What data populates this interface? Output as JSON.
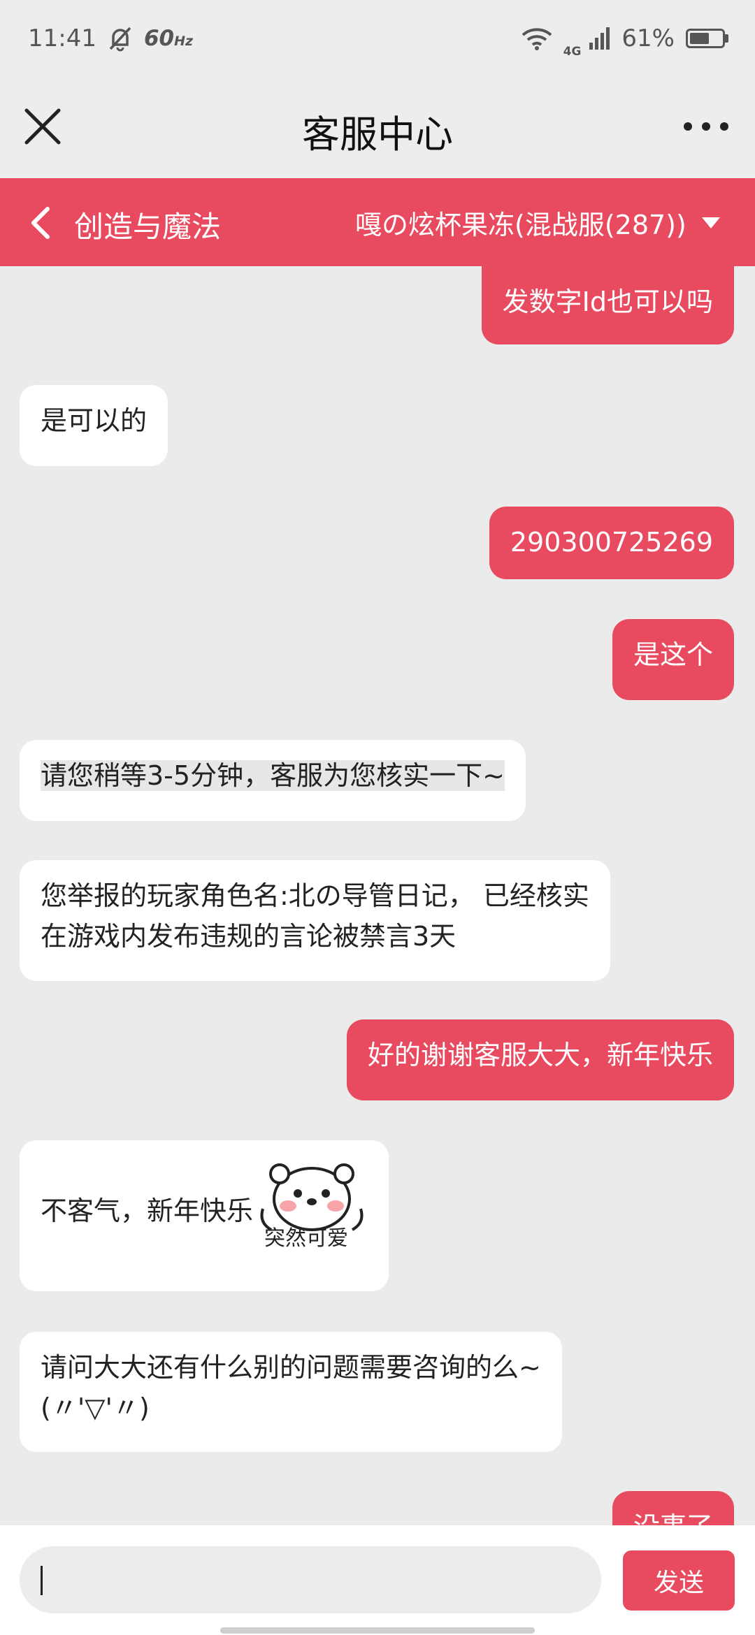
{
  "status_bar": {
    "time": "11:41",
    "refresh_rate": "60",
    "refresh_unit": "Hz",
    "network": "4G",
    "battery": "61%",
    "battery_level": 0.61
  },
  "header": {
    "title": "客服中心"
  },
  "game_bar": {
    "game_name": "创造与魔法",
    "server": "嘎の炫杯果冻(混战服(287))"
  },
  "messages": [
    {
      "side": "out",
      "text": "发数字Id也可以吗"
    },
    {
      "side": "in",
      "text": "是可以的"
    },
    {
      "side": "out",
      "text": "290300725269"
    },
    {
      "side": "out",
      "text": "是这个"
    },
    {
      "side": "in",
      "text": "请您稍等3-5分钟，客服为您核实一下~"
    },
    {
      "side": "in",
      "lines": [
        "您举报的玩家角色名:北の导管日记， 已经核实",
        "在游戏内发布违规的言论被禁言3天"
      ]
    },
    {
      "side": "out",
      "text": "好的谢谢客服大大，新年快乐"
    },
    {
      "side": "in",
      "text": "不客气，新年快乐",
      "sticker_caption": "突然可爱"
    },
    {
      "side": "in",
      "lines": [
        "请问大大还有什么别的问题需要咨询的么~",
        "(〃'▽'〃)"
      ]
    },
    {
      "side": "out",
      "text": "没事了"
    }
  ],
  "input": {
    "value": "",
    "send_label": "发送"
  },
  "colors": {
    "accent": "#e84a5f",
    "background": "#ebebeb"
  }
}
